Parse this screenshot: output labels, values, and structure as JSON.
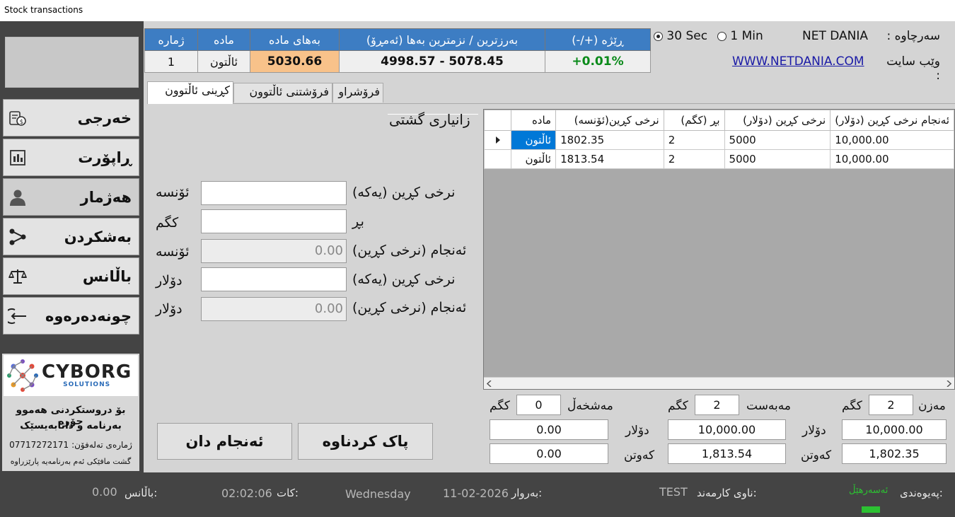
{
  "window": {
    "title": "Stock transactions"
  },
  "sidebar": {
    "items": [
      {
        "label": "خەرجی",
        "icon": "money-icon"
      },
      {
        "label": "ڕاپۆرت",
        "icon": "report-icon"
      },
      {
        "label": "هەژمار",
        "icon": "user-icon"
      },
      {
        "label": "بەشکردن",
        "icon": "share-icon"
      },
      {
        "label": "باڵانس",
        "icon": "scale-icon"
      },
      {
        "label": "چونەدەرەوە",
        "icon": "logout-icon"
      }
    ],
    "brand": {
      "name": "CYBORG",
      "sub": "SOLUTIONS",
      "line1": "بۆ دروستکردنی هەموو جۆرە",
      "line2": "بەرنامە و داتابەیسێک",
      "phone_label": "ژمارەی تەلەفۆن:",
      "phone": "07717272171",
      "copyright": "گشت مافێکی ئەم بەرنامەیە پارێزراوە"
    }
  },
  "price_table": {
    "headers": [
      "ژمارە",
      "مادە",
      "بەهای مادە",
      "بەرزترین / نزمترین بەها (ئەمڕۆ)",
      "ڕێژە (+/-)"
    ],
    "row": {
      "number": "1",
      "material": "ئاڵتون",
      "price": "5030.66",
      "range": "4998.57 - 5078.45",
      "change": "+0.01%"
    }
  },
  "refresh": {
    "opt1": "30 Sec",
    "opt2": "1 Min",
    "selected": "30 Sec"
  },
  "source": {
    "label": "سەرچاوە :",
    "value": "NET DANIA",
    "site_label": "وێب سایت :",
    "site": "WWW.NETDANIA.COM"
  },
  "tabs": [
    "کڕینی ئاڵتوون",
    "فرۆشتنی ئاڵتوون",
    "فرۆشراو"
  ],
  "form": {
    "section_title": "زانیاری گشتی",
    "rows": [
      {
        "label": "نرخی کڕین (یەکە)",
        "value": "",
        "unit": "ئۆنسە",
        "readonly": false
      },
      {
        "label": "بڕ",
        "value": "",
        "unit": "کگم",
        "readonly": false
      },
      {
        "label": "ئەنجام (نرخی کڕین)",
        "value": "0.00",
        "unit": "ئۆنسە",
        "readonly": true
      },
      {
        "label": "نرخی کڕین (یەکە)",
        "value": "",
        "unit": "دۆلار",
        "readonly": false
      },
      {
        "label": "ئەنجام (نرخی کڕین)",
        "value": "0.00",
        "unit": "دۆلار",
        "readonly": true
      }
    ],
    "submit_label": "ئەنجام دان",
    "clear_label": "پاک کردناوە"
  },
  "grid": {
    "columns": [
      "مادە",
      "نرخی کڕین(ئۆنسە)",
      "بڕ (کگم)",
      "نرخی کڕین (دۆلار)",
      "ئەنجام نرخی کڕین (دۆلار)"
    ],
    "rows": [
      [
        "ئاڵتون",
        "1802.35",
        "2",
        "5000",
        "10,000.00"
      ],
      [
        "ئاڵتون",
        "1813.54",
        "2",
        "5000",
        "10,000.00"
      ]
    ]
  },
  "summary": {
    "mazn_label": "مەزن",
    "mazn_value": "2",
    "mazn_unit": "کگم",
    "mabast_label": "مەبەست",
    "mabast_value": "2",
    "mabast_unit": "کگم",
    "mashkhal_label": "مەشخەڵ",
    "mashkhal_value": "0",
    "mashkhal_unit": "کگم",
    "dollar_label": "دۆلار",
    "kawtn_label": "کەوتن",
    "col1_dollar": "10,000.00",
    "col1_kawtn": "1,802.35",
    "col2_dollar": "10,000.00",
    "col2_kawtn": "1,813.54",
    "col3_dollar": "0.00",
    "col3_kawtn": "0.00"
  },
  "status": {
    "connection_label": "پەیوەندی:",
    "connection_value": "ئەسەرهێڵ",
    "user_label": "ناوی کارمەند:",
    "user_value": "TEST",
    "date_label": "بەروار:",
    "date_value": "11-02-2026",
    "day_value": "Wednesday",
    "time_label": "کات:",
    "time_value": "02:02:06",
    "balance_label": "باڵانس:",
    "balance_value": "0.00"
  },
  "colors": {
    "header_blue": "#3d7dc3",
    "price_highlight": "#f8c28a",
    "positive_green": "#0a8a1a",
    "sidebar_dark": "#444444",
    "selected_row": "#0078d7",
    "online_green": "#2cc132"
  }
}
